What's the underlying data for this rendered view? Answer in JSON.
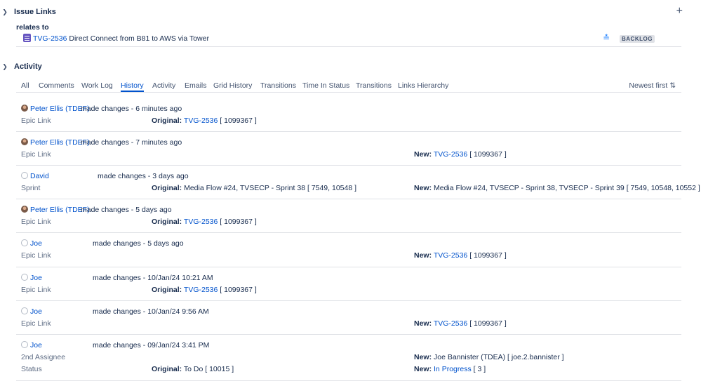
{
  "issue_links": {
    "title": "Issue Links",
    "relation": "relates to",
    "link": {
      "key": "TVG-2536",
      "summary": "Direct Connect from B81 to AWS via Tower",
      "status": "BACKLOG"
    }
  },
  "activity": {
    "title": "Activity",
    "tabs": [
      "All",
      "Comments",
      "Work Log",
      "History",
      "Activity",
      "Emails",
      "Grid History",
      "Transitions",
      "Time In Status",
      "Transitions",
      "Links Hierarchy"
    ],
    "active_tab": "History",
    "sort_label": "Newest first",
    "entries": [
      {
        "author": "Peter Ellis (TDEF)",
        "action": "made changes - 6 minutes ago",
        "changes": [
          {
            "field": "Epic Link",
            "original_label": "Original:",
            "original_link": "TVG-2536",
            "original_text": " [ 1099367 ]",
            "new_label": "",
            "new_link": "",
            "new_text": ""
          }
        ]
      },
      {
        "author": "Peter Ellis (TDEF)",
        "action": "made changes - 7 minutes ago",
        "changes": [
          {
            "field": "Epic Link",
            "original_label": "",
            "original_link": "",
            "original_text": "",
            "new_label": "New:",
            "new_link": "TVG-2536",
            "new_text": " [ 1099367 ]"
          }
        ]
      },
      {
        "author": "David",
        "action": "made changes - 3 days ago",
        "changes": [
          {
            "field": "Sprint",
            "original_label": "Original:",
            "original_link": "",
            "original_text": " Media Flow #24, TVSECP - Sprint 38 [ 7549, 10548 ]",
            "new_label": "New:",
            "new_link": "",
            "new_text": " Media Flow #24, TVSECP - Sprint 38, TVSECP - Sprint 39 [ 7549, 10548, 10552 ]"
          }
        ]
      },
      {
        "author": "Peter Ellis (TDEF)",
        "action": "made changes - 5 days ago",
        "changes": [
          {
            "field": "Epic Link",
            "original_label": "Original:",
            "original_link": "TVG-2536",
            "original_text": " [ 1099367 ]",
            "new_label": "",
            "new_link": "",
            "new_text": ""
          }
        ]
      },
      {
        "author": "Joe",
        "action": "made changes - 5 days ago",
        "changes": [
          {
            "field": "Epic Link",
            "original_label": "",
            "original_link": "",
            "original_text": "",
            "new_label": "New:",
            "new_link": "TVG-2536",
            "new_text": " [ 1099367 ]"
          }
        ]
      },
      {
        "author": "Joe",
        "action": "made changes - 10/Jan/24 10:21 AM",
        "changes": [
          {
            "field": "Epic Link",
            "original_label": "Original:",
            "original_link": "TVG-2536",
            "original_text": " [ 1099367 ]",
            "new_label": "",
            "new_link": "",
            "new_text": ""
          }
        ]
      },
      {
        "author": "Joe",
        "action": "made changes - 10/Jan/24 9:56 AM",
        "changes": [
          {
            "field": "Epic Link",
            "original_label": "",
            "original_link": "",
            "original_text": "",
            "new_label": "New:",
            "new_link": "TVG-2536",
            "new_text": " [ 1099367 ]"
          }
        ]
      },
      {
        "author": "Joe",
        "action": "made changes - 09/Jan/24 3:41 PM",
        "changes": [
          {
            "field": "2nd Assignee",
            "original_label": "",
            "original_link": "",
            "original_text": "",
            "new_label": "New:",
            "new_link": "",
            "new_text": " Joe Bannister (TDEA) [ joe.2.bannister ]"
          },
          {
            "field": "Status",
            "original_label": "Original:",
            "original_link": "",
            "original_text": " To Do [ 10015 ]",
            "new_label": "New:",
            "new_link": "In Progress",
            "new_text": " [ 3 ]"
          }
        ]
      }
    ]
  }
}
